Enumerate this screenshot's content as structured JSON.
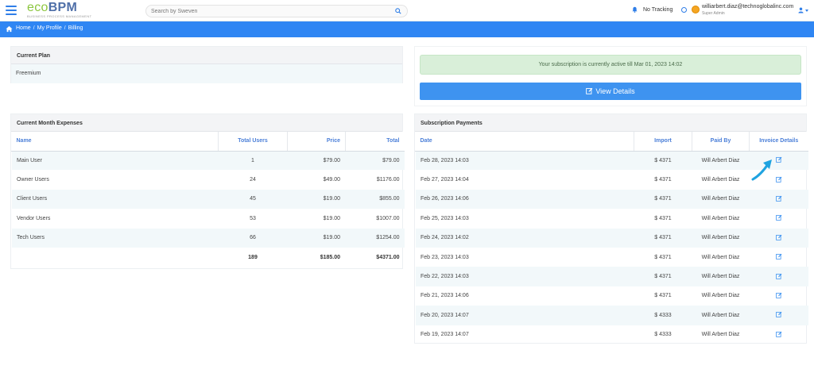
{
  "app": {
    "logo_main": "ecoBPM",
    "logo_eco": "eco",
    "logo_bpm": "BPM",
    "logo_tagline": "BUSINESS PROCESS MANAGEMENT"
  },
  "header": {
    "search_placeholder": "Search by Sweven",
    "tracking_label": "No Tracking",
    "user_email": "williarbert.diaz@technoglobalinc.com",
    "user_role": "Super Admin"
  },
  "breadcrumb": {
    "items": [
      "Home",
      "My Profile",
      "Billing"
    ]
  },
  "current_plan": {
    "title": "Current Plan",
    "value": "Freemium"
  },
  "subscription": {
    "alert": "Your subscription is currently active till Mar 01, 2023 14:02",
    "view_details_label": "View Details"
  },
  "expenses": {
    "title": "Current Month Expenses",
    "columns": [
      "Name",
      "Total Users",
      "Price",
      "Total"
    ],
    "rows": [
      {
        "name": "Main User",
        "users": "1",
        "price": "$79.00",
        "total": "$79.00"
      },
      {
        "name": "Owner Users",
        "users": "24",
        "price": "$49.00",
        "total": "$1176.00"
      },
      {
        "name": "Client Users",
        "users": "45",
        "price": "$19.00",
        "total": "$855.00"
      },
      {
        "name": "Vendor Users",
        "users": "53",
        "price": "$19.00",
        "total": "$1007.00"
      },
      {
        "name": "Tech Users",
        "users": "66",
        "price": "$19.00",
        "total": "$1254.00"
      }
    ],
    "totals": {
      "users": "189",
      "price": "$185.00",
      "total": "$4371.00"
    }
  },
  "payments": {
    "title": "Subscription Payments",
    "columns": [
      "Date",
      "Import",
      "Paid By",
      "Invoice Details"
    ],
    "rows": [
      {
        "date": "Feb 28, 2023 14:03",
        "import": "$ 4371",
        "paid_by": "Will Arbert Diaz"
      },
      {
        "date": "Feb 27, 2023 14:04",
        "import": "$ 4371",
        "paid_by": "Will Arbert Diaz"
      },
      {
        "date": "Feb 26, 2023 14:06",
        "import": "$ 4371",
        "paid_by": "Will Arbert Diaz"
      },
      {
        "date": "Feb 25, 2023 14:03",
        "import": "$ 4371",
        "paid_by": "Will Arbert Diaz"
      },
      {
        "date": "Feb 24, 2023 14:02",
        "import": "$ 4371",
        "paid_by": "Will Arbert Diaz"
      },
      {
        "date": "Feb 23, 2023 14:03",
        "import": "$ 4371",
        "paid_by": "Will Arbert Diaz"
      },
      {
        "date": "Feb 22, 2023 14:03",
        "import": "$ 4371",
        "paid_by": "Will Arbert Diaz"
      },
      {
        "date": "Feb 21, 2023 14:06",
        "import": "$ 4371",
        "paid_by": "Will Arbert Diaz"
      },
      {
        "date": "Feb 20, 2023 14:07",
        "import": "$ 4333",
        "paid_by": "Will Arbert Diaz"
      },
      {
        "date": "Feb 19, 2023 14:07",
        "import": "$ 4333",
        "paid_by": "Will Arbert Diaz"
      }
    ]
  },
  "colors": {
    "accent": "#2f86f3",
    "button": "#3e93f0",
    "alert_bg": "#d9efd9",
    "header_link": "#4b7fd8",
    "arrow": "#1fa3e0"
  },
  "icons": [
    "menu-icon",
    "search-icon",
    "bell-icon",
    "clock-icon",
    "user-icon",
    "home-icon",
    "edit-icon",
    "invoice-edit-icon"
  ]
}
